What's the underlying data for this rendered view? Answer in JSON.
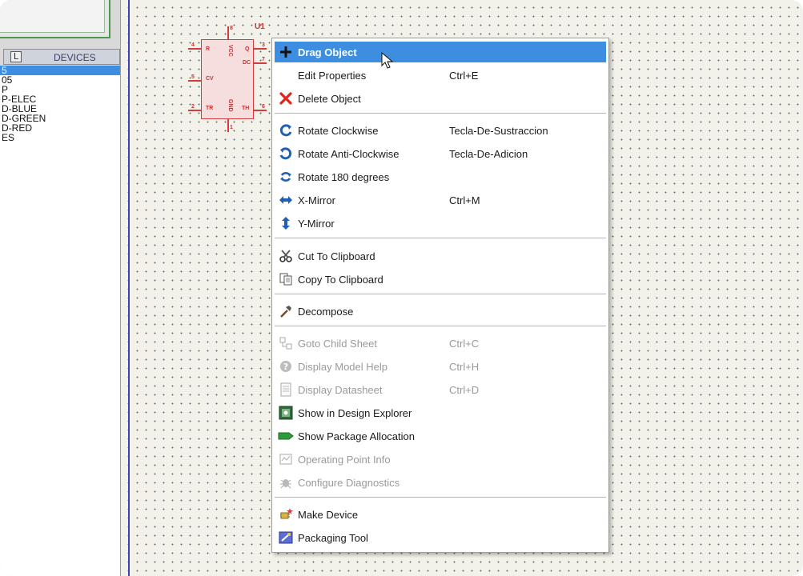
{
  "left_panel": {
    "list_mode_button": "L",
    "header_title": "DEVICES",
    "devices": [
      {
        "label": "5",
        "selected": true
      },
      {
        "label": "05",
        "selected": false
      },
      {
        "label": "P",
        "selected": false
      },
      {
        "label": "P-ELEC",
        "selected": false
      },
      {
        "label": "D-BLUE",
        "selected": false
      },
      {
        "label": "D-GREEN",
        "selected": false
      },
      {
        "label": "D-RED",
        "selected": false
      },
      {
        "label": "ES",
        "selected": false
      }
    ]
  },
  "component": {
    "reference": "U1",
    "pins": {
      "r": "R",
      "q": "Q",
      "dc": "DC",
      "cv": "CV",
      "tr": "TR",
      "th": "TH",
      "gnd": "GND",
      "vcc": "VCC"
    },
    "pin_numbers": {
      "p4": "4",
      "p8": "8",
      "p3": "3",
      "p7": "7",
      "p5": "5",
      "p2": "2",
      "p6": "6",
      "p1": "1"
    }
  },
  "context_menu": {
    "items": {
      "drag_object": {
        "label": "Drag Object",
        "shortcut": ""
      },
      "edit_properties": {
        "label": "Edit Properties",
        "shortcut": "Ctrl+E"
      },
      "delete_object": {
        "label": "Delete Object",
        "shortcut": ""
      },
      "rotate_cw": {
        "label": "Rotate Clockwise",
        "shortcut": "Tecla-De-Sustraccion"
      },
      "rotate_ccw": {
        "label": "Rotate Anti-Clockwise",
        "shortcut": "Tecla-De-Adicion"
      },
      "rotate_180": {
        "label": "Rotate 180 degrees",
        "shortcut": ""
      },
      "x_mirror": {
        "label": "X-Mirror",
        "shortcut": "Ctrl+M"
      },
      "y_mirror": {
        "label": "Y-Mirror",
        "shortcut": ""
      },
      "cut": {
        "label": "Cut To Clipboard",
        "shortcut": ""
      },
      "copy": {
        "label": "Copy To Clipboard",
        "shortcut": ""
      },
      "decompose": {
        "label": "Decompose",
        "shortcut": ""
      },
      "goto_child": {
        "label": "Goto Child Sheet",
        "shortcut": "Ctrl+C"
      },
      "model_help": {
        "label": "Display Model Help",
        "shortcut": "Ctrl+H"
      },
      "datasheet": {
        "label": "Display Datasheet",
        "shortcut": "Ctrl+D"
      },
      "design_explorer": {
        "label": "Show in Design Explorer",
        "shortcut": ""
      },
      "package_allocation": {
        "label": "Show Package Allocation",
        "shortcut": ""
      },
      "operating_point": {
        "label": "Operating Point Info",
        "shortcut": ""
      },
      "diagnostics": {
        "label": "Configure Diagnostics",
        "shortcut": ""
      },
      "make_device": {
        "label": "Make Device",
        "shortcut": ""
      },
      "packaging_tool": {
        "label": "Packaging Tool",
        "shortcut": ""
      }
    }
  },
  "colors": {
    "highlight": "#3d8ee0",
    "component_red": "#d63a3a",
    "canvas_bg": "#f2f2ea"
  }
}
